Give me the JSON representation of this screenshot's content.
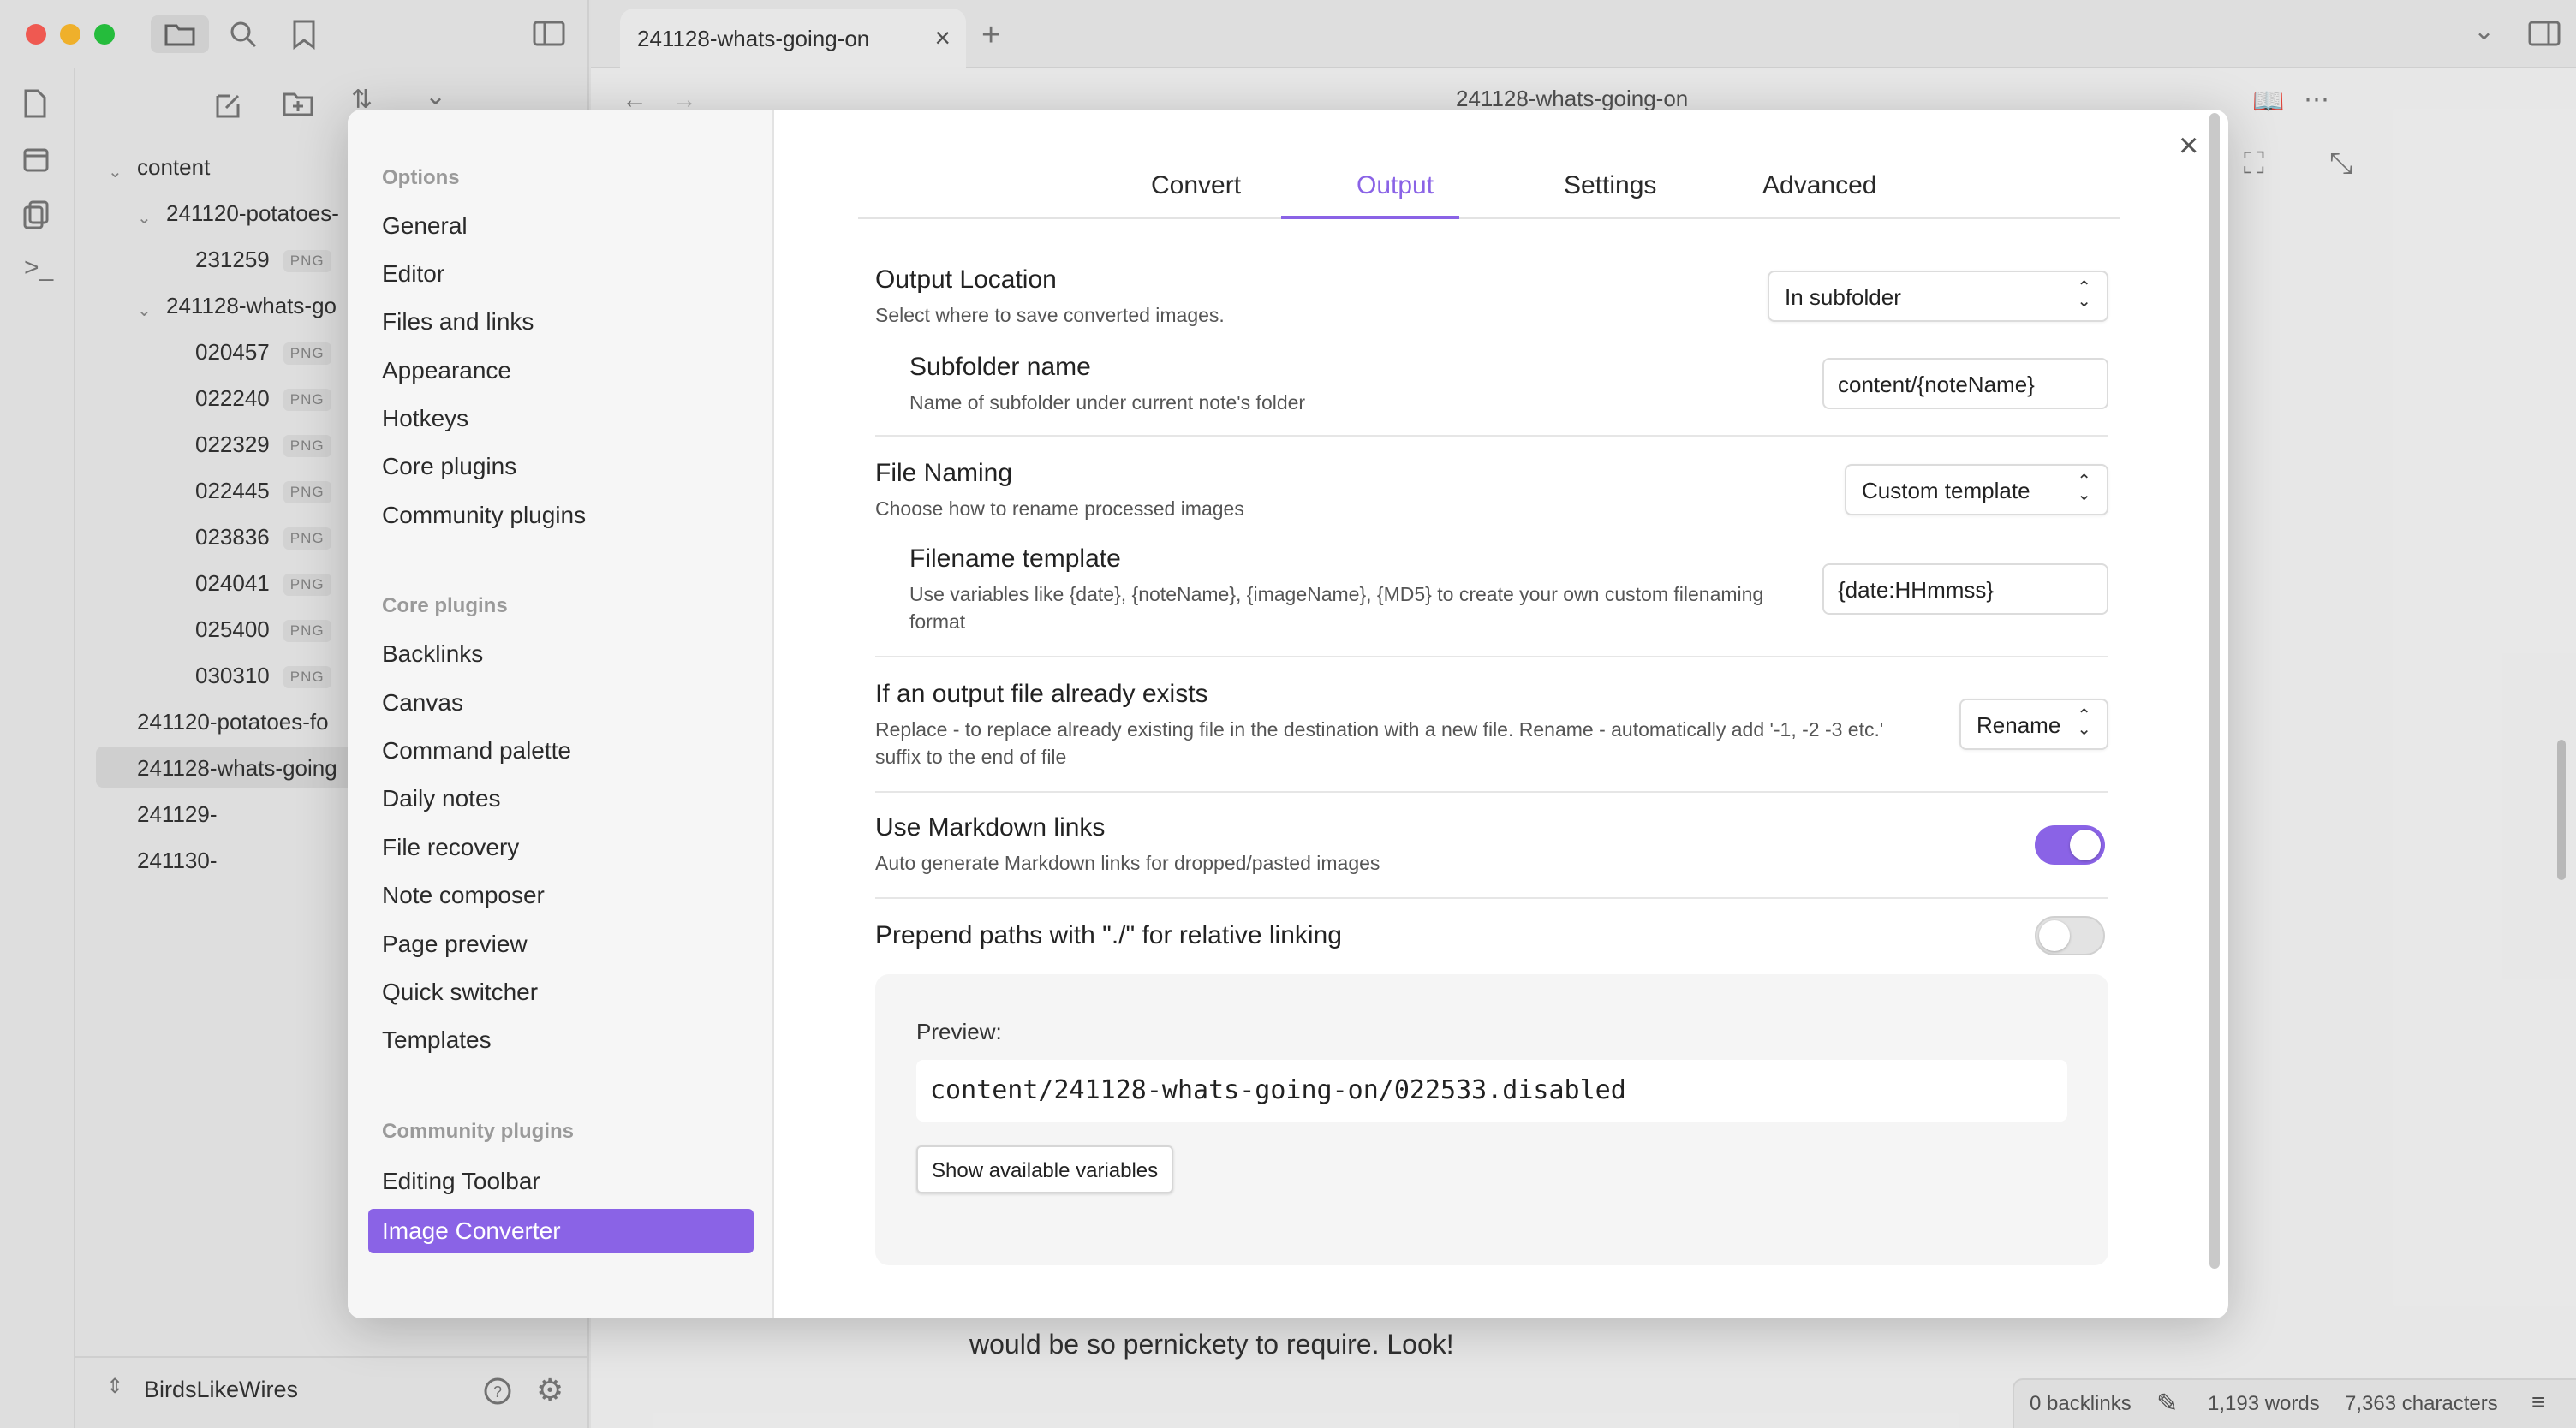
{
  "window": {
    "tab_title": "241128-whats-going-on",
    "note_title": "241128-whats-going-on"
  },
  "file_tree": {
    "root": "content",
    "folder1": "241120-potatoes-",
    "folder1_files": [
      {
        "name": "231259",
        "type": "PNG"
      }
    ],
    "folder2": "241128-whats-go",
    "folder2_files": [
      {
        "name": "020457",
        "type": "PNG"
      },
      {
        "name": "022240",
        "type": "PNG"
      },
      {
        "name": "022329",
        "type": "PNG"
      },
      {
        "name": "022445",
        "type": "PNG"
      },
      {
        "name": "023836",
        "type": "PNG"
      },
      {
        "name": "024041",
        "type": "PNG"
      },
      {
        "name": "025400",
        "type": "PNG"
      },
      {
        "name": "030310",
        "type": "PNG"
      }
    ],
    "notes": [
      "241120-potatoes-fo",
      "241128-whats-going",
      "241129-",
      "241130-"
    ]
  },
  "vault_name": "BirdsLikeWires",
  "editor": {
    "visible_text": "would be so pernickety to require. Look!"
  },
  "status_bar": {
    "backlinks": "0 backlinks",
    "words": "1,193 words",
    "characters": "7,363 characters"
  },
  "settings_sidebar": {
    "options_heading": "Options",
    "options": [
      "General",
      "Editor",
      "Files and links",
      "Appearance",
      "Hotkeys",
      "Core plugins",
      "Community plugins"
    ],
    "core_heading": "Core plugins",
    "core": [
      "Backlinks",
      "Canvas",
      "Command palette",
      "Daily notes",
      "File recovery",
      "Note composer",
      "Page preview",
      "Quick switcher",
      "Templates"
    ],
    "community_heading": "Community plugins",
    "community": [
      "Editing Toolbar",
      "Image Converter"
    ]
  },
  "tabs": [
    "Convert",
    "Output",
    "Settings",
    "Advanced"
  ],
  "settings": {
    "output_location": {
      "name": "Output Location",
      "desc": "Select where to save converted images.",
      "value": "In subfolder"
    },
    "subfolder_name": {
      "name": "Subfolder name",
      "desc": "Name of subfolder under current note's folder",
      "value": "content/{noteName}"
    },
    "file_naming": {
      "name": "File Naming",
      "desc": "Choose how to rename processed images",
      "value": "Custom template"
    },
    "filename_template": {
      "name": "Filename template",
      "desc": "Use variables like {date}, {noteName}, {imageName}, {MD5} to create your own custom filenaming format",
      "value": "{date:HHmmss}"
    },
    "file_exists": {
      "name": "If an output file already exists",
      "desc": "Replace - to replace already existing file in the destination with a new file. Rename - automatically add '-1, -2 -3 etc.' suffix to the end of file",
      "value": "Rename"
    },
    "markdown_links": {
      "name": "Use Markdown links",
      "desc": "Auto generate Markdown links for dropped/pasted images",
      "enabled": true
    },
    "prepend_paths": {
      "name": "Prepend paths with \"./\" for relative linking",
      "enabled": false
    }
  },
  "preview": {
    "label": "Preview:",
    "path": "content/241128-whats-going-on/022533.disabled",
    "button": "Show available variables"
  },
  "colors": {
    "accent": "#8a63e6",
    "sidebar_bg": "#ececec",
    "modal_side_bg": "#f6f6f6"
  }
}
